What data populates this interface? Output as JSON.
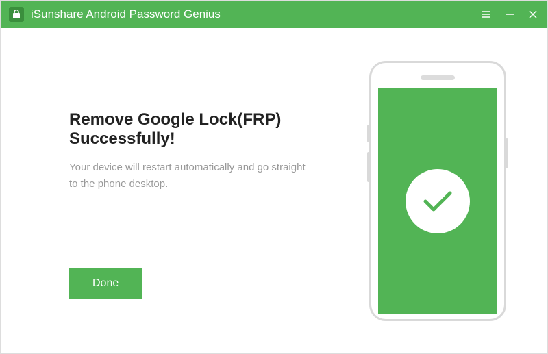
{
  "titlebar": {
    "app_title": "iSunshare Android Password Genius"
  },
  "main": {
    "heading": "Remove Google Lock(FRP) Successfully!",
    "subtext": "Your device will restart automatically and go straight to the phone desktop.",
    "done_label": "Done"
  },
  "colors": {
    "accent": "#52b455"
  }
}
